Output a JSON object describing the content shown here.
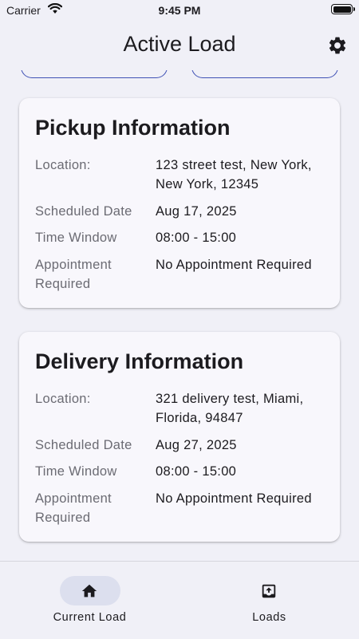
{
  "status_bar": {
    "carrier": "Carrier",
    "time": "9:45 PM"
  },
  "header": {
    "title": "Active Load",
    "settings_icon": "gear-icon"
  },
  "pickup": {
    "title": "Pickup Information",
    "rows": [
      {
        "label": "Location:",
        "value": "123 street test, New York, New York, 12345"
      },
      {
        "label": "Scheduled Date",
        "value": "Aug 17, 2025"
      },
      {
        "label": "Time Window",
        "value": "08:00 - 15:00"
      },
      {
        "label": "Appointment Required",
        "value": "No Appointment Required"
      }
    ]
  },
  "delivery": {
    "title": "Delivery Information",
    "rows": [
      {
        "label": "Location:",
        "value": "321 delivery test, Miami, Florida, 94847"
      },
      {
        "label": "Scheduled Date",
        "value": "Aug 27, 2025"
      },
      {
        "label": "Time Window",
        "value": "08:00 - 15:00"
      },
      {
        "label": "Appointment Required",
        "value": "No Appointment Required"
      }
    ]
  },
  "bottom_nav": {
    "items": [
      {
        "label": "Current Load",
        "icon": "home-icon",
        "selected": true
      },
      {
        "label": "Loads",
        "icon": "upload-icon",
        "selected": false
      }
    ]
  },
  "colors": {
    "background": "#f0f0f7",
    "card": "#f8f7fc",
    "nav_indicator": "#dcdfee",
    "outline": "#3f51b5"
  }
}
